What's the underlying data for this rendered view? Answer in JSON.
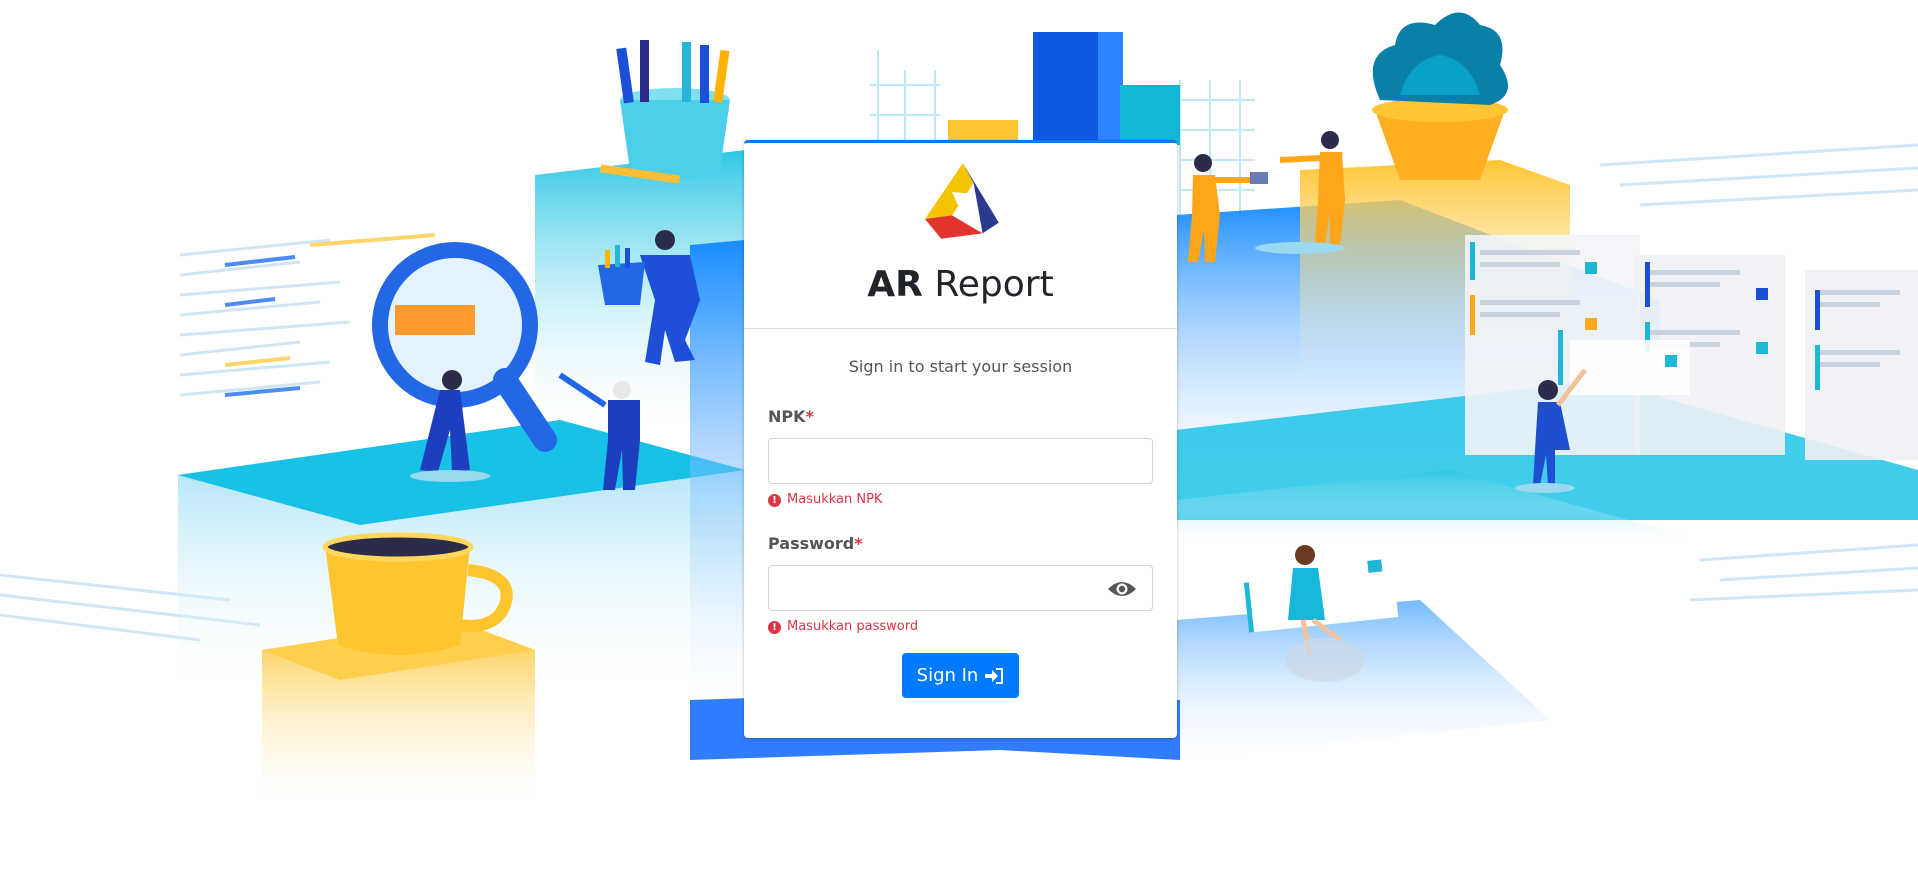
{
  "app": {
    "title_bold": "AR",
    "title_rest": "Report"
  },
  "login": {
    "message": "Sign in to start your session",
    "npk_label": "NPK",
    "npk_required_mark": "*",
    "npk_value": "",
    "npk_error": "Masukkan NPK",
    "password_label": "Password",
    "password_required_mark": "*",
    "password_value": "",
    "password_error": "Masukkan password",
    "submit_label": "Sign In",
    "submit_icon": "sign-in-icon",
    "show_password_icon": "eye-icon"
  },
  "colors": {
    "primary": "#007bff",
    "error": "#dc3545",
    "logo_yellow": "#f5c400",
    "logo_red": "#e2342d",
    "logo_navy": "#2b3a8f"
  }
}
